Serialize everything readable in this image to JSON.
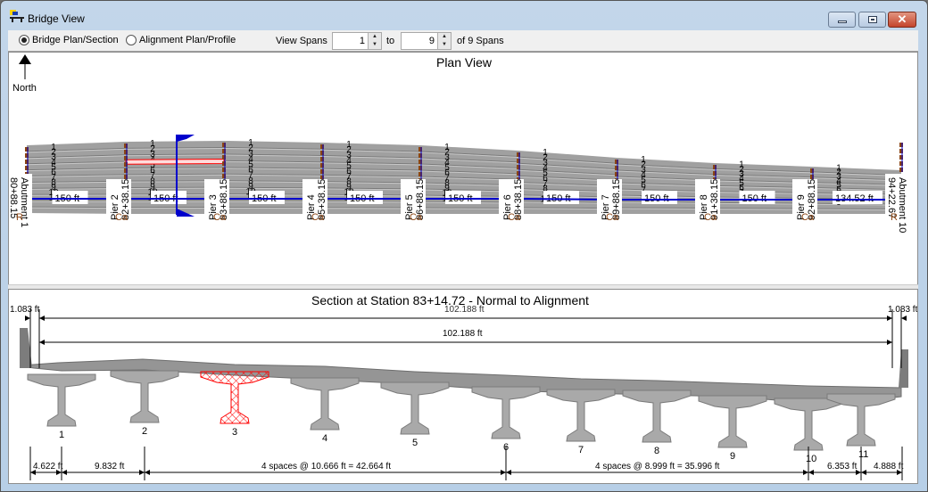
{
  "window": {
    "title": "Bridge View",
    "buttons": {
      "minimize": "minimize",
      "maximize": "maximize",
      "close": "✕"
    }
  },
  "toolbar": {
    "radio_bridge": {
      "label": "Bridge Plan/Section",
      "selected": true
    },
    "radio_alignment": {
      "label": "Alignment Plan/Profile",
      "selected": false
    },
    "view_spans_label": "View Spans",
    "span_from": "1",
    "to_label": "to",
    "span_to": "9",
    "of_label": "of 9 Spans"
  },
  "plan_view": {
    "title": "Plan View",
    "north_label": "North",
    "supports": [
      {
        "name": "Abutment 1",
        "station": "80+88.15",
        "tag": "R"
      },
      {
        "name": "Pier 2",
        "station": "82+38.15",
        "tag": "Ca"
      },
      {
        "name": "Pier 3",
        "station": "83+88.15",
        "tag": "Ca"
      },
      {
        "name": "Pier 4",
        "station": "85+38.15",
        "tag": "Ca"
      },
      {
        "name": "Pier 5",
        "station": "86+88.15",
        "tag": "Ca"
      },
      {
        "name": "Pier 6",
        "station": "88+38.15",
        "tag": "Ca"
      },
      {
        "name": "Pier 7",
        "station": "89+88.15",
        "tag": "Ca"
      },
      {
        "name": "Pier 8",
        "station": "91+38.15",
        "tag": "Ca"
      },
      {
        "name": "Pier 9",
        "station": "92+88.15",
        "tag": "Ca"
      },
      {
        "name": "Abutment 10",
        "station": "94+22.67",
        "tag": "R"
      }
    ],
    "spans": [
      "150 ft",
      "150 ft",
      "150 ft",
      "150 ft",
      "150 ft",
      "150 ft",
      "150 ft",
      "150 ft",
      "134.52 ft"
    ],
    "girder_counts": [
      11,
      11,
      11,
      11,
      11,
      10,
      9,
      9,
      9
    ],
    "selected_span": 2,
    "selected_girder": 3,
    "colors": {
      "alignment": "#0000cc",
      "deck": "#a0a0a0",
      "support": "#8b4513",
      "selected": "#ff0000"
    }
  },
  "section_view": {
    "title": "Section at Station 83+14.72 - Normal to Alignment",
    "overhang_left": "1.083 ft",
    "overhang_right": "1.083 ft",
    "width_top": "102.188 ft",
    "width_inner": "102.188 ft",
    "girders": [
      "1",
      "2",
      "3",
      "4",
      "5",
      "6",
      "7",
      "8",
      "9",
      "10",
      "11"
    ],
    "selected_girder": "3",
    "spacing_dims": [
      "4.622 ft",
      "9.832 ft",
      "4 spaces @ 10.666 ft = 42.664 ft",
      "4 spaces @ 8.999 ft = 35.996 ft",
      "6.353 ft",
      "4.888 ft"
    ]
  }
}
